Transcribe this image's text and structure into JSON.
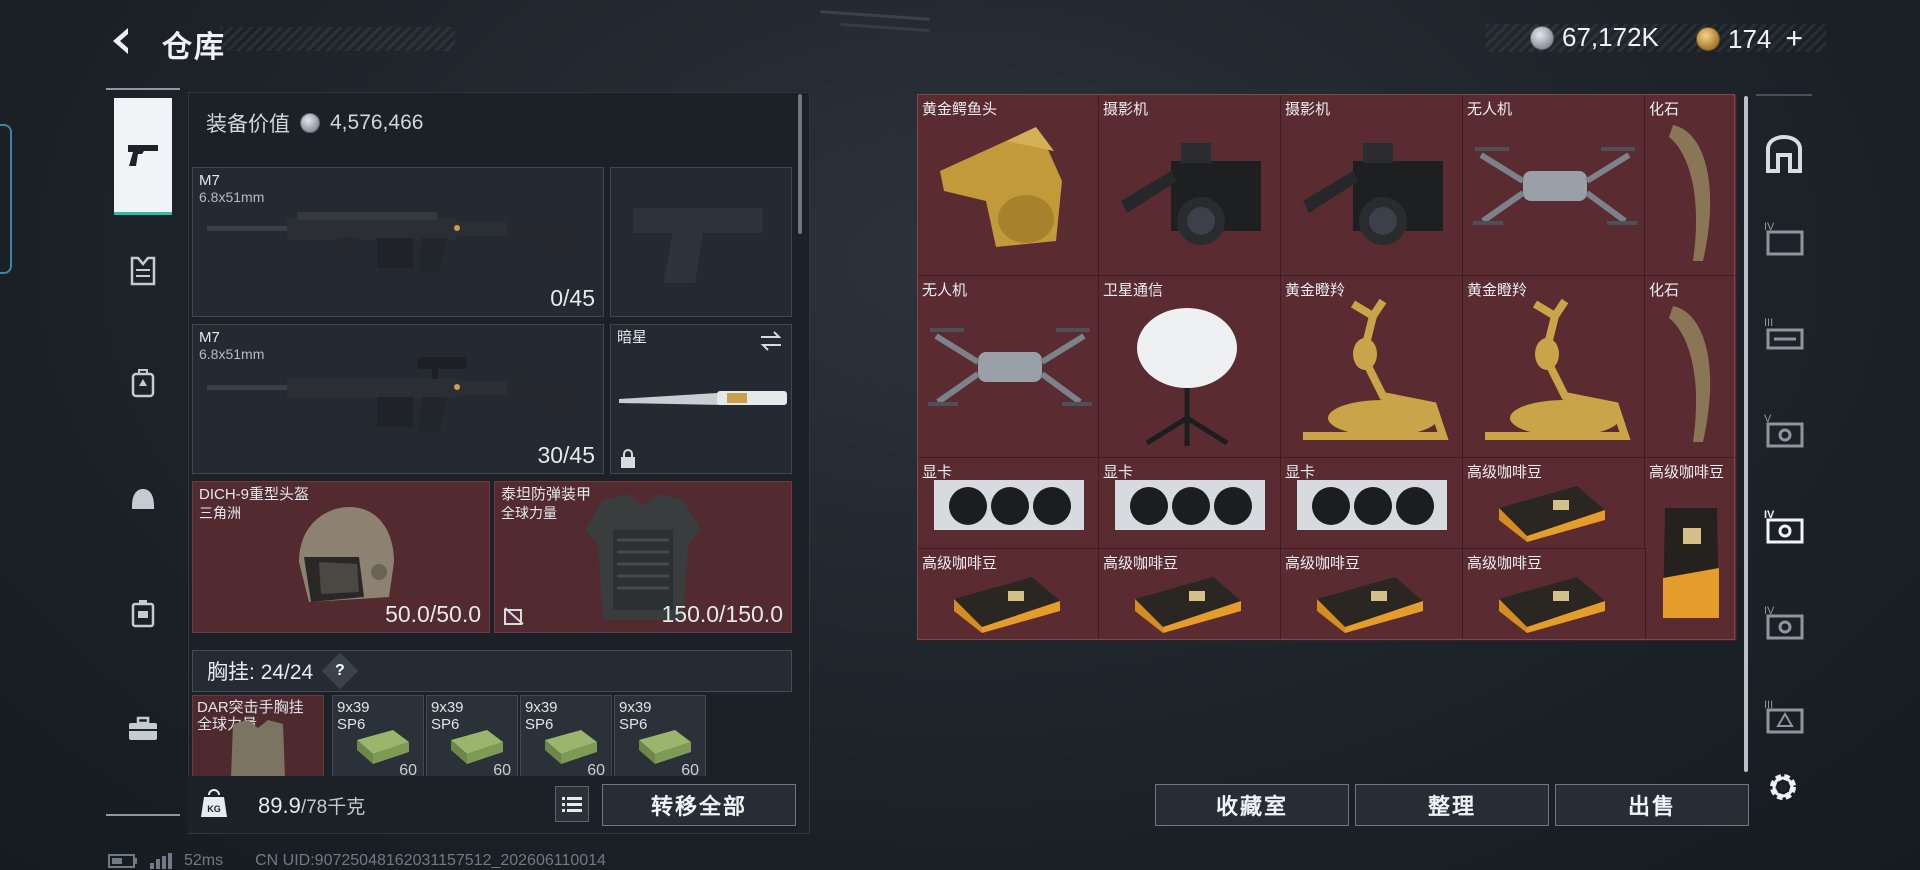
{
  "header": {
    "title": "仓库",
    "silver_currency": "67,172K",
    "gold_currency": "174",
    "add_symbol": "+"
  },
  "equipment": {
    "value_label": "装备价值",
    "value": "4,576,466",
    "primary_weapon": {
      "name": "M7",
      "caliber": "6.8x51mm",
      "ammo": "0/45"
    },
    "secondary_weapon": {
      "name": "M7",
      "caliber": "6.8x51mm",
      "ammo": "30/45"
    },
    "melee": {
      "name": "暗星"
    },
    "helmet": {
      "name": "DICH-9重型头盔",
      "faction": "三角洲",
      "durability": "50.0/50.0"
    },
    "armor": {
      "name": "泰坦防弹装甲",
      "faction": "全球力量",
      "durability": "150.0/150.0"
    },
    "chest_rig": {
      "label": "胸挂:",
      "capacity": "24/24",
      "help": "?"
    },
    "rig_items": [
      {
        "name": "DAR突击手胸挂",
        "sub": "全球力量",
        "count": ""
      },
      {
        "name": "9x39",
        "sub": "SP6",
        "count": "60"
      },
      {
        "name": "9x39",
        "sub": "SP6",
        "count": "60"
      },
      {
        "name": "9x39",
        "sub": "SP6",
        "count": "60"
      },
      {
        "name": "9x39",
        "sub": "SP6",
        "count": "60"
      }
    ]
  },
  "weight": {
    "current": "89.9",
    "limit": "/78千克"
  },
  "actions": {
    "transfer_all": "转移全部",
    "collection_room": "收藏室",
    "organize": "整理",
    "sell": "出售"
  },
  "storage_items": [
    "黄金鳄鱼头",
    "摄影机",
    "摄影机",
    "无人机",
    "化石",
    "无人机",
    "卫星通信",
    "黄金瞪羚",
    "黄金瞪羚",
    "化石",
    "显卡",
    "显卡",
    "显卡",
    "高级咖啡豆",
    "高级咖啡豆",
    "高级咖啡豆",
    "高级咖啡豆",
    "高级咖啡豆",
    "高级咖啡豆"
  ],
  "right_nav": [
    "IV",
    "III",
    "V",
    "IV",
    "IV",
    "III"
  ],
  "status": {
    "ping": "52ms",
    "uid": "CN UID:9072504816203115751​2_202606110014"
  },
  "colors": {
    "accent": "#2dbfa6",
    "item_bg": "#5a2b31"
  }
}
